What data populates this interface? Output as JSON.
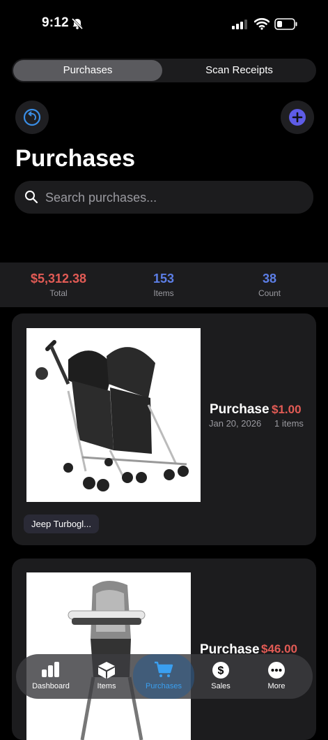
{
  "status_bar": {
    "time": "9:12"
  },
  "segmented": {
    "tabs": [
      "Purchases",
      "Scan Receipts"
    ]
  },
  "header": {
    "title": "Purchases"
  },
  "search": {
    "placeholder": "Search purchases..."
  },
  "summary": {
    "total_value": "$5,312.38",
    "total_label": "Total",
    "items_value": "153",
    "items_label": "Items",
    "count_value": "38",
    "count_label": "Count"
  },
  "purchases": [
    {
      "title": "Purchase",
      "price": "$1.00",
      "date": "Jan 20, 2026",
      "items": "1 items",
      "tag": "Jeep Turbogl...",
      "image": "double-stroller"
    },
    {
      "title": "Purchase",
      "price": "$46.00",
      "image": "high-chair"
    }
  ],
  "tabbar": {
    "tabs": [
      {
        "label": "Dashboard",
        "icon": "bar-chart-icon"
      },
      {
        "label": "Items",
        "icon": "box-icon"
      },
      {
        "label": "Purchases",
        "icon": "cart-icon"
      },
      {
        "label": "Sales",
        "icon": "dollar-icon"
      },
      {
        "label": "More",
        "icon": "more-icon"
      }
    ]
  },
  "colors": {
    "accent_purple": "#5e5ce6",
    "accent_blue": "#3a8ee6",
    "price_red": "#e25b55",
    "stat_blue": "#5c7ee6"
  }
}
